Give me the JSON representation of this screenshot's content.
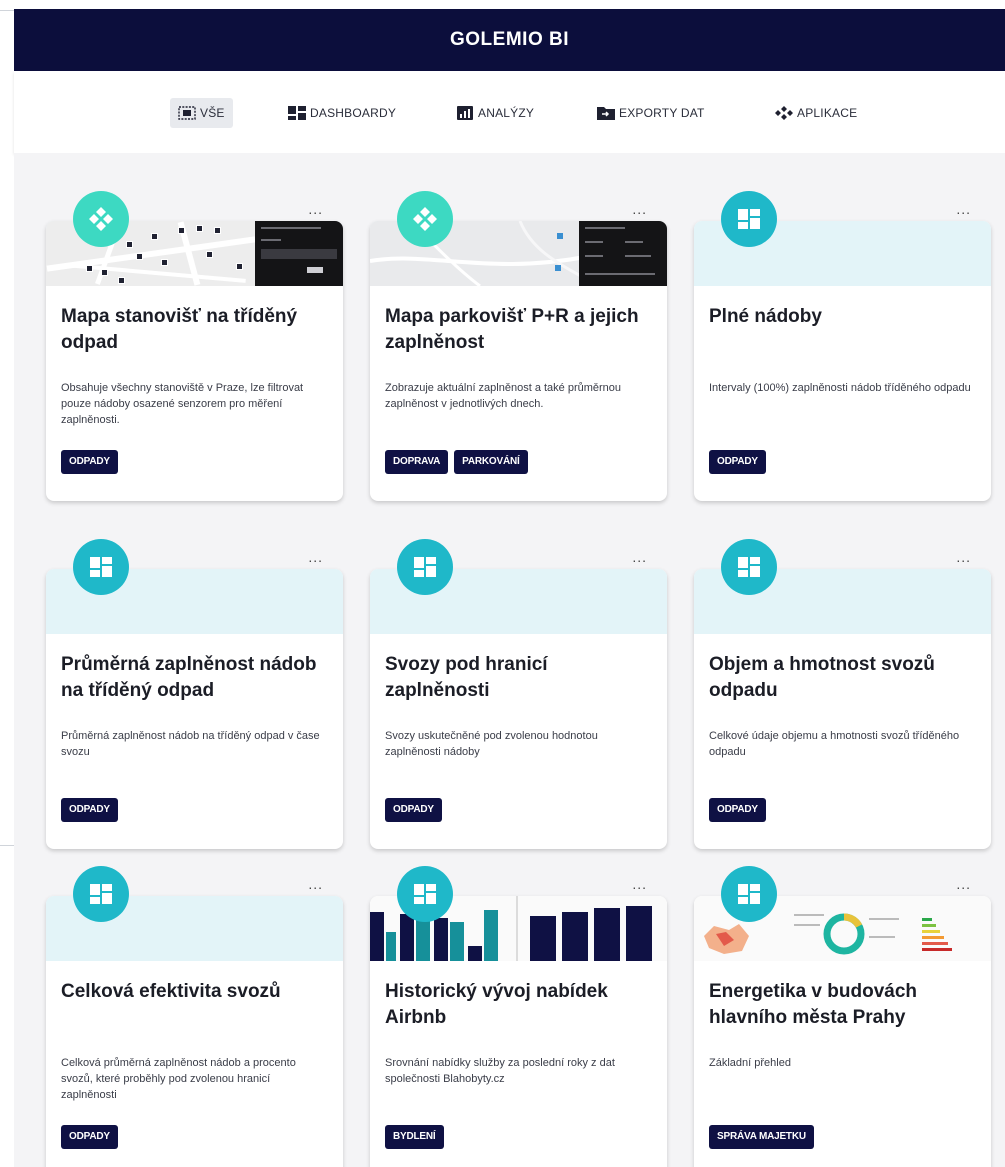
{
  "header": {
    "title": "GOLEMIO BI"
  },
  "filters": [
    {
      "label": "VŠE",
      "icon": "all-icon",
      "active": true
    },
    {
      "label": "DASHBOARDY",
      "icon": "dashboard-icon",
      "active": false
    },
    {
      "label": "ANALÝZY",
      "icon": "analysis-icon",
      "active": false
    },
    {
      "label": "EXPORTY DAT",
      "icon": "export-icon",
      "active": false
    },
    {
      "label": "APLIKACE",
      "icon": "app-icon",
      "active": false
    }
  ],
  "cards": [
    {
      "title": "Mapa stanovišť na tříděný odpad",
      "desc": "Obsahuje všechny stanoviště v Praze, lze filtrovat pouze nádoby osazené senzorem pro měření zaplněnosti.",
      "tags": [
        "ODPADY"
      ],
      "type": "app",
      "more": "..."
    },
    {
      "title": "Mapa parkovišť P+R a jejich zaplněnost",
      "desc": "Zobrazuje aktuální zaplněnost a také průměrnou zaplněnost v jednotlivých dnech.",
      "tags": [
        "DOPRAVA",
        "PARKOVÁNÍ"
      ],
      "type": "app",
      "more": "..."
    },
    {
      "title": "Plné nádoby",
      "desc": "Intervaly (100%) zaplněnosti nádob tříděného odpadu",
      "tags": [
        "ODPADY"
      ],
      "type": "dashboard",
      "more": "..."
    },
    {
      "title": "Průměrná zaplněnost nádob na tříděný odpad",
      "desc": "Průměrná zaplněnost nádob na tříděný odpad v čase svozu",
      "tags": [
        "ODPADY"
      ],
      "type": "dashboard",
      "more": "..."
    },
    {
      "title": "Svozy pod hranicí zaplněnosti",
      "desc": "Svozy uskutečněné pod zvolenou hodnotou zaplněnosti nádoby",
      "tags": [
        "ODPADY"
      ],
      "type": "dashboard",
      "more": "..."
    },
    {
      "title": "Objem a hmotnost svozů odpadu",
      "desc": "Celkové údaje objemu a hmotnosti svozů tříděného odpadu",
      "tags": [
        "ODPADY"
      ],
      "type": "dashboard",
      "more": "..."
    },
    {
      "title": "Celková efektivita svozů",
      "desc": "Celková průměrná zaplněnost nádob a procento svozů, které proběhly pod zvolenou hranicí zaplněnosti",
      "tags": [
        "ODPADY"
      ],
      "type": "dashboard",
      "more": "..."
    },
    {
      "title": "Historický vývoj nabídek Airbnb",
      "desc": "Srovnání nabídky služby za poslední roky z dat společnosti Blahobyty.cz",
      "tags": [
        "BYDLENÍ"
      ],
      "type": "dashboard",
      "more": "..."
    },
    {
      "title": "Energetika v budovách hlavního města Prahy",
      "desc": "Základní přehled",
      "tags": [
        "SPRÁVA MAJETKU"
      ],
      "type": "dashboard",
      "more": "..."
    }
  ],
  "colors": {
    "header_bg": "#0c0e3c",
    "tag_bg": "#0f1144",
    "app_badge": "#3dd9c2",
    "dashboard_badge": "#1fb8c9",
    "banner_bg": "#e3f4f8"
  }
}
